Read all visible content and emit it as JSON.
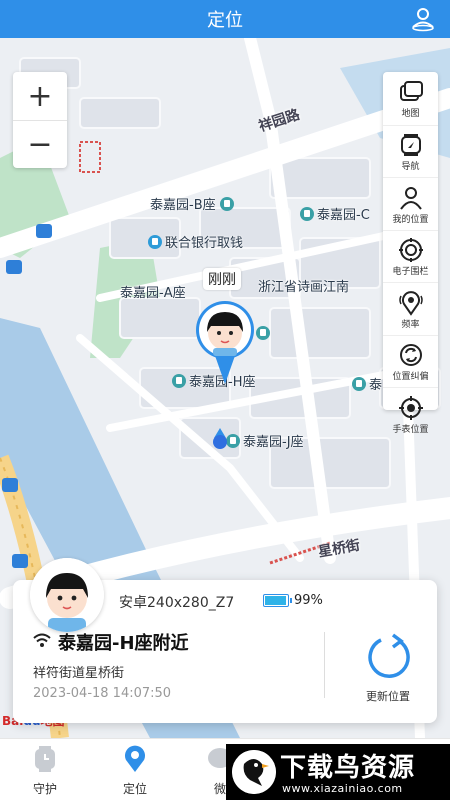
{
  "header": {
    "title": "定位",
    "user_icon": "user-location-icon"
  },
  "map": {
    "zoom_in": "+",
    "zoom_out": "−",
    "roads": {
      "xiangyuan": "祥园路",
      "xingqiao": "星桥街"
    },
    "pois": {
      "b_block": "泰嘉园-B座",
      "bank": "联合银行取钱",
      "a_block": "泰嘉园-A座",
      "zhejiang": "浙江省诗画江南",
      "h_block": "泰嘉园-H座",
      "j_block": "泰嘉园-J座",
      "c_block": "泰嘉园-C",
      "right_edge": "泰"
    },
    "marker_tip": "刚刚",
    "watermark": {
      "red": "Bai",
      "blue": "du",
      "suffix": "地图"
    }
  },
  "tools": [
    {
      "label": "地图",
      "icon": "map-layers-icon"
    },
    {
      "label": "导航",
      "icon": "watch-navigation-icon"
    },
    {
      "label": "我的位置",
      "icon": "my-location-person-icon"
    },
    {
      "label": "电子围栏",
      "icon": "geofence-icon"
    },
    {
      "label": "频率",
      "icon": "frequency-pin-icon"
    },
    {
      "label": "位置纠偏",
      "icon": "location-correction-icon"
    },
    {
      "label": "手表位置",
      "icon": "watch-location-target-icon"
    }
  ],
  "card": {
    "device": "安卓240x280_Z7",
    "battery": "99%",
    "battery_level": 0.99,
    "place": "泰嘉园-H座附近",
    "street": "祥符街道星桥街",
    "time": "2023-04-18 14:07:50",
    "refresh_label": "更新位置"
  },
  "bottom_nav": [
    {
      "label": "守护",
      "icon": "guard-icon"
    },
    {
      "label": "定位",
      "icon": "location-pin-icon"
    },
    {
      "label": "微",
      "icon": "chat-icon"
    }
  ],
  "watermark": {
    "title": "下载鸟资源",
    "url": "www.xiazainiao.com"
  },
  "colors": {
    "primary": "#2f8fe8",
    "poi": "#3aa0a6"
  }
}
